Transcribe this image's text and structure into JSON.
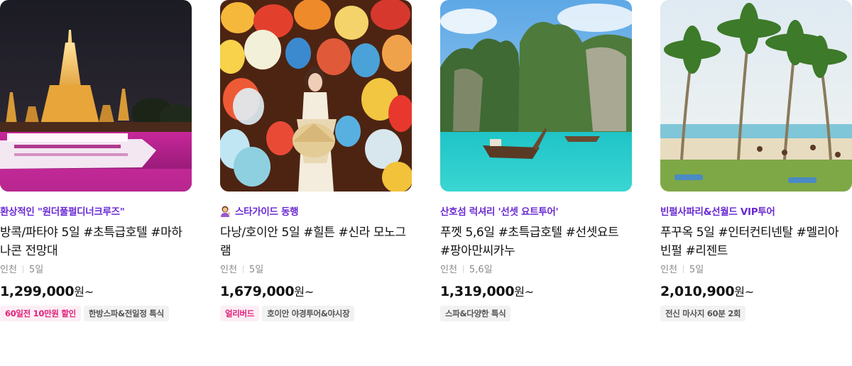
{
  "products": [
    {
      "image_alt": "방콕 왓아룬 야경과 디너크루즈",
      "subtitle": "환상적인 \"원더풀펄디너크루즈\"",
      "title": "방콕/파타야 5일 #초특급호텔 #마하나콘 전망대",
      "departure": "인천",
      "duration": "5일",
      "price": "1,299,000",
      "price_unit": "원~",
      "tags": [
        {
          "label": "60일전 10만원 할인",
          "style": "pink"
        },
        {
          "label": "한방스파&전일정 특식",
          "style": "gray"
        }
      ]
    },
    {
      "image_alt": "호이안 등불 거리의 아오자이 여성",
      "subtitle_icon": "woman-tipping-hand-icon",
      "subtitle": "스타가이드 동행",
      "title": "다낭/호이안 5일 #힐튼 #신라 모노그램",
      "departure": "인천",
      "duration": "5일",
      "price": "1,679,000",
      "price_unit": "원~",
      "tags": [
        {
          "label": "얼리버드",
          "style": "pink"
        },
        {
          "label": "호이안 야경투어&야시장",
          "style": "gray"
        }
      ]
    },
    {
      "image_alt": "피피섬 에메랄드 바다와 롱테일보트",
      "subtitle": "산호섬 럭셔리 '선셋 요트투어'",
      "title": "푸껫 5,6일 #초특급호텔 #선셋요트 #팡아만씨카누",
      "departure": "인천",
      "duration": "5,6일",
      "price": "1,319,000",
      "price_unit": "원~",
      "tags": [
        {
          "label": "스파&다양한 특식",
          "style": "gray"
        }
      ]
    },
    {
      "image_alt": "푸꾸옥 야자수 해변",
      "subtitle": "빈펄사파리&선월드 VIP투어",
      "title": "푸꾸옥 5일 #인터컨티넨탈 #멜리아 빈펄 #리젠트",
      "departure": "인천",
      "duration": "5일",
      "price": "2,010,900",
      "price_unit": "원~",
      "tags": [
        {
          "label": "전신 마사지 60분 2회",
          "style": "gray"
        }
      ]
    }
  ],
  "colors": {
    "subtitle": "#6a2bd3",
    "pink_tag_bg": "#fdeef5",
    "pink_tag_text": "#e0217a",
    "gray_tag_bg": "#f2f2f2",
    "gray_tag_text": "#555555"
  }
}
